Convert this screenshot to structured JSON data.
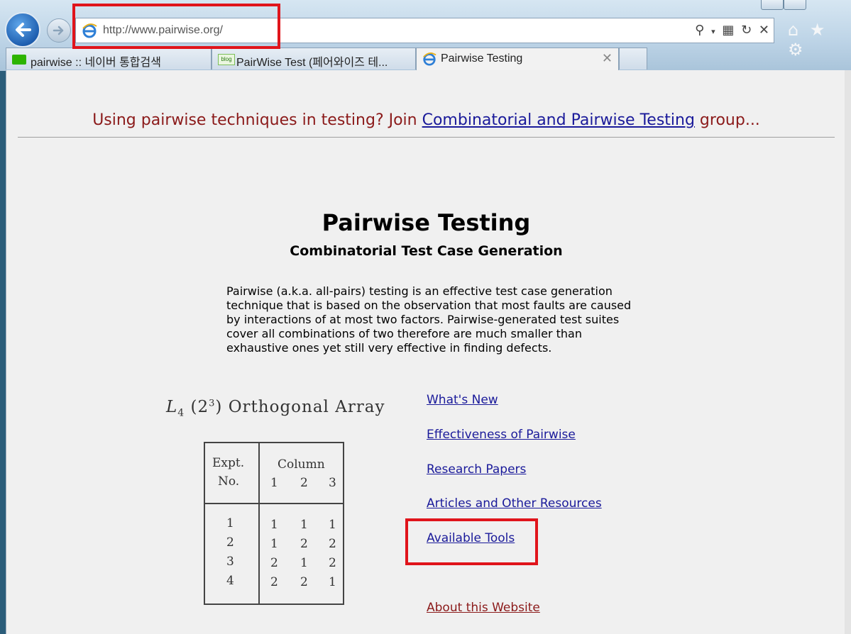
{
  "browser": {
    "url": "http://www.pairwise.org/",
    "tabs": [
      {
        "label": "pairwise :: 네이버 통합검색",
        "active": false
      },
      {
        "label": "PairWise Test (페어와이즈 테...",
        "active": false
      },
      {
        "label": "Pairwise Testing",
        "active": true
      }
    ],
    "icons": [
      "back-arrow-icon",
      "forward-arrow-icon",
      "ie-icon",
      "search-icon",
      "refresh-icon",
      "stop-icon",
      "home-icon",
      "favorites-star-icon",
      "settings-gear-icon"
    ]
  },
  "notice": {
    "before": "Using pairwise techniques in testing? Join ",
    "link": "Combinatorial and Pairwise Testing",
    "after": " group..."
  },
  "page": {
    "title": "Pairwise Testing",
    "subtitle": "Combinatorial Test Case Generation",
    "intro": "Pairwise (a.k.a. all-pairs) testing is an effective test case generation technique that is based on the observation that most faults are caused by interactions of at most two factors. Pairwise-generated test suites cover all combinations of two therefore are much smaller than exhaustive ones yet still very effective in finding defects."
  },
  "orthogonal_array": {
    "title_prefix": "L",
    "title_sub": "4",
    "title_mid": " (2",
    "title_sup": "3",
    "title_rest": ") Orthogonal Array",
    "header_expt": "Expt.",
    "header_no": "No.",
    "header_column": "Column",
    "column_numbers": [
      "1",
      "2",
      "3"
    ],
    "rows": [
      {
        "no": "1",
        "values": [
          "1",
          "1",
          "1"
        ]
      },
      {
        "no": "2",
        "values": [
          "1",
          "2",
          "2"
        ]
      },
      {
        "no": "3",
        "values": [
          "2",
          "1",
          "2"
        ]
      },
      {
        "no": "4",
        "values": [
          "2",
          "2",
          "1"
        ]
      }
    ]
  },
  "links": {
    "whats_new": "What's New",
    "effectiveness": "Effectiveness of Pairwise",
    "research": "Research Papers",
    "articles": "Articles and Other Resources",
    "tools": "Available Tools",
    "about": "About this Website"
  },
  "colors": {
    "highlight": "#e0141b",
    "link": "#1a1a9a",
    "notice": "#8b1a1a"
  }
}
